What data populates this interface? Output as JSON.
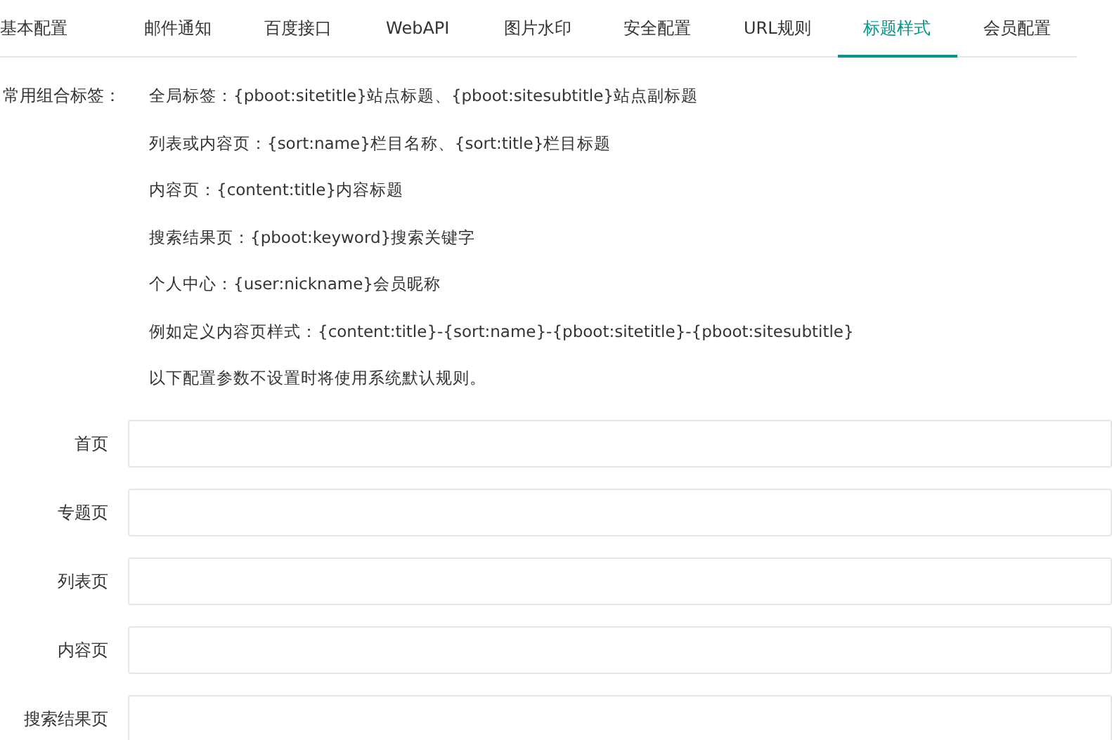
{
  "tabs": [
    {
      "label": "基本配置",
      "selected": false
    },
    {
      "label": "邮件通知",
      "selected": false
    },
    {
      "label": "百度接口",
      "selected": false
    },
    {
      "label": "WebAPI",
      "selected": false
    },
    {
      "label": "图片水印",
      "selected": false
    },
    {
      "label": "安全配置",
      "selected": false
    },
    {
      "label": "URL规则",
      "selected": false
    },
    {
      "label": "标题样式",
      "selected": true
    },
    {
      "label": "会员配置",
      "selected": false
    }
  ],
  "tags_help": {
    "label": "常用组合标签：",
    "lines": [
      "全局标签：{pboot:sitetitle}站点标题、{pboot:sitesubtitle}站点副标题",
      "列表或内容页：{sort:name}栏目名称、{sort:title}栏目标题",
      "内容页：{content:title}内容标题",
      "搜索结果页：{pboot:keyword}搜索关键字",
      "个人中心：{user:nickname}会员昵称",
      "例如定义内容页样式：{content:title}-{sort:name}-{pboot:sitetitle}-{pboot:sitesubtitle}",
      "以下配置参数不设置时将使用系统默认规则。"
    ]
  },
  "fields": [
    {
      "label": "首页"
    },
    {
      "label": "专题页"
    },
    {
      "label": "列表页"
    },
    {
      "label": "内容页"
    },
    {
      "label": "搜索结果页"
    }
  ]
}
